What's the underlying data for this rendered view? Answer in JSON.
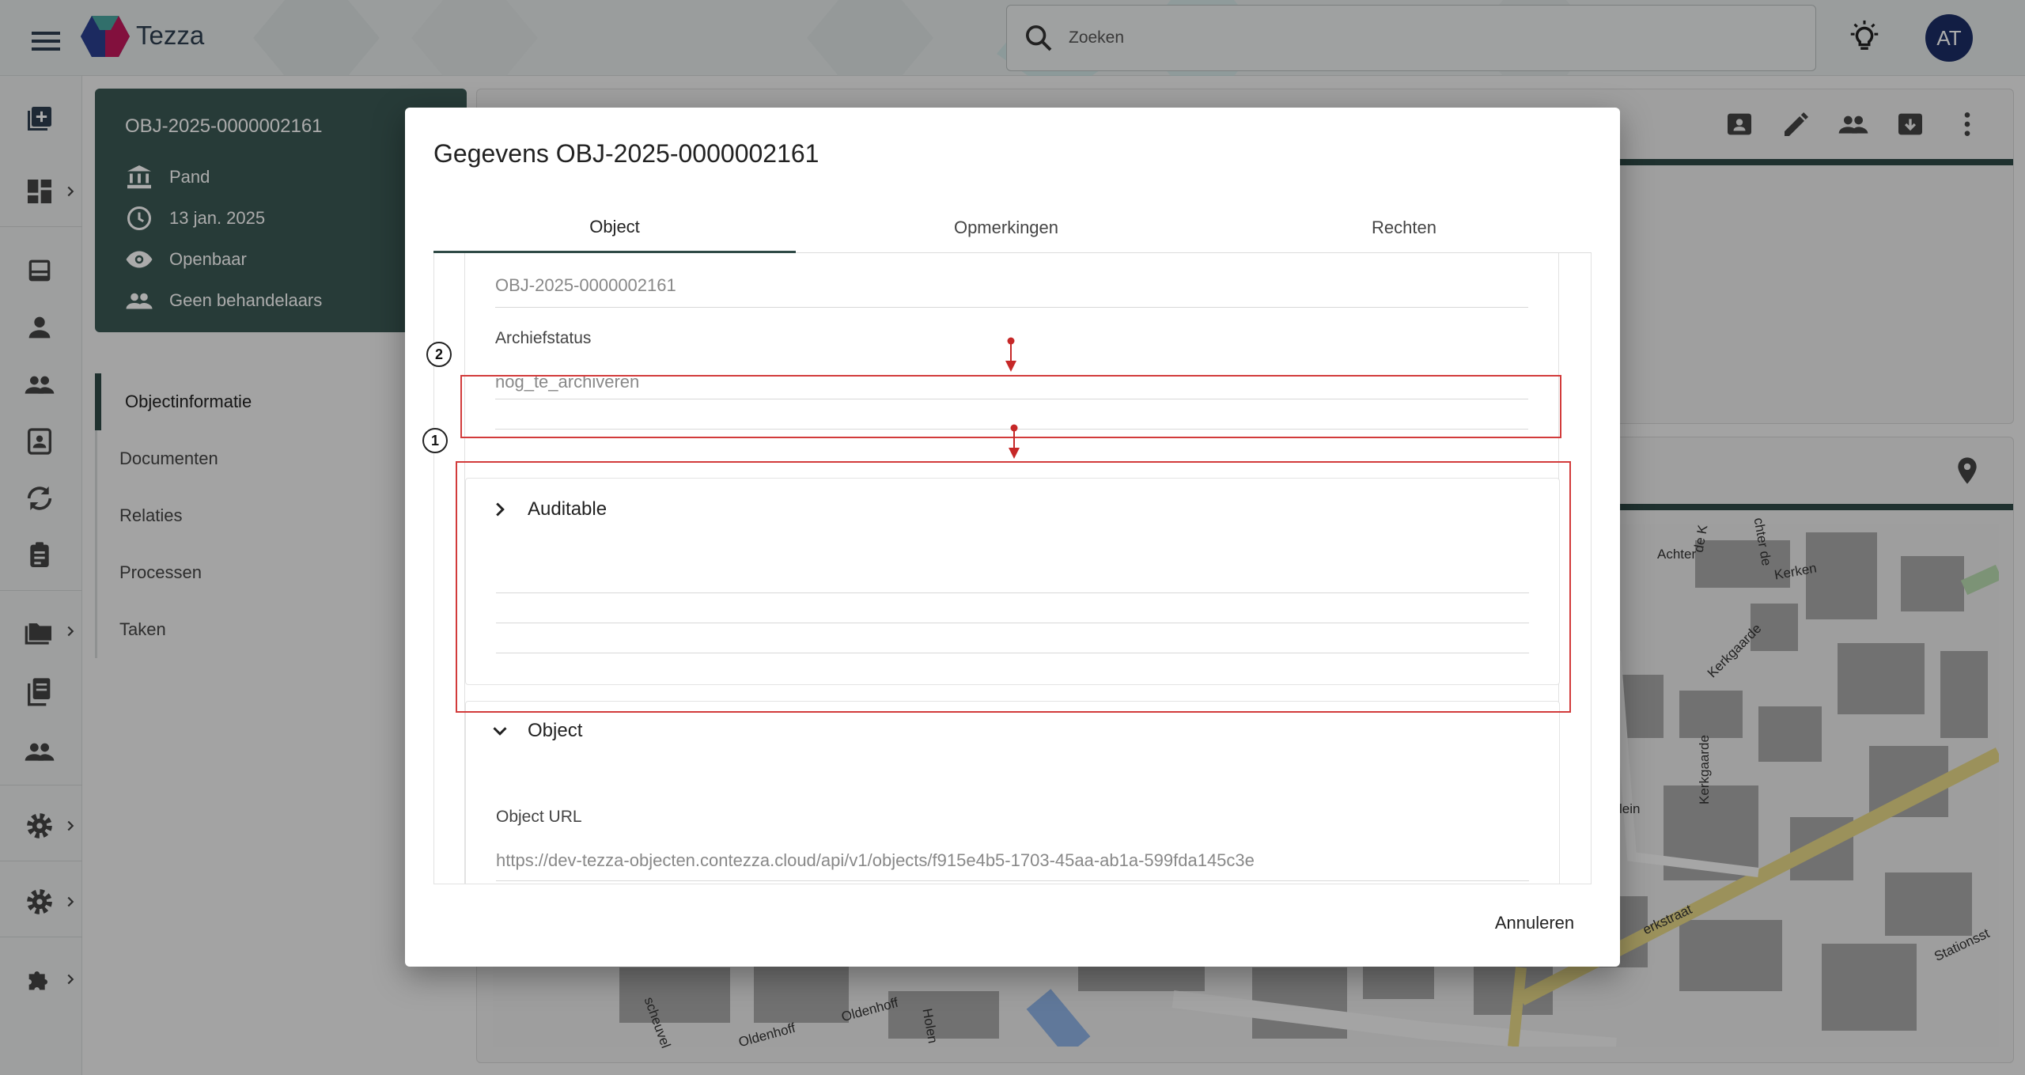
{
  "app": {
    "brand": "Tezza"
  },
  "search": {
    "placeholder": "Zoeken"
  },
  "user": {
    "initials": "AT"
  },
  "info_card": {
    "title": "OBJ-2025-0000002161",
    "rows": [
      {
        "icon": "bank-icon",
        "text": "Pand"
      },
      {
        "icon": "clock-icon",
        "text": "13 jan. 2025"
      },
      {
        "icon": "eye-icon",
        "text": "Openbaar"
      },
      {
        "icon": "people-icon",
        "text": "Geen behandelaars"
      }
    ]
  },
  "left_nav": {
    "items": [
      "Objectinformatie",
      "Documenten",
      "Relaties",
      "Processen",
      "Taken"
    ]
  },
  "dialog": {
    "title": "Gegevens OBJ-2025-0000002161",
    "tabs": [
      "Object",
      "Opmerkingen",
      "Rechten"
    ],
    "fields": {
      "id_value": "OBJ-2025-0000002161",
      "archief_label": "Archiefstatus",
      "archief_value": "nog_te_archiveren",
      "auditable_title": "Auditable",
      "object_title": "Object",
      "url_label": "Object URL",
      "url_value": "https://dev-tezza-objecten.contezza.cloud/api/v1/objects/f915e4b5-1703-45aa-ab1a-599fda145c3e"
    },
    "annotations": [
      "1",
      "2"
    ],
    "cancel_label": "Annuleren"
  },
  "map": {
    "labels": [
      "Achter",
      "de K",
      "chter de",
      "Kerken",
      "Kerkgaarde",
      "Kerkgaarde",
      "lein",
      "erkstraat",
      "Stationsst",
      "Oldenhoff",
      "Oldenhoff",
      "Holen",
      "scheuvel"
    ]
  },
  "colors": {
    "accent": "#2f4a46",
    "annotation": "#d23b3b",
    "avatar": "#1b2e66"
  }
}
